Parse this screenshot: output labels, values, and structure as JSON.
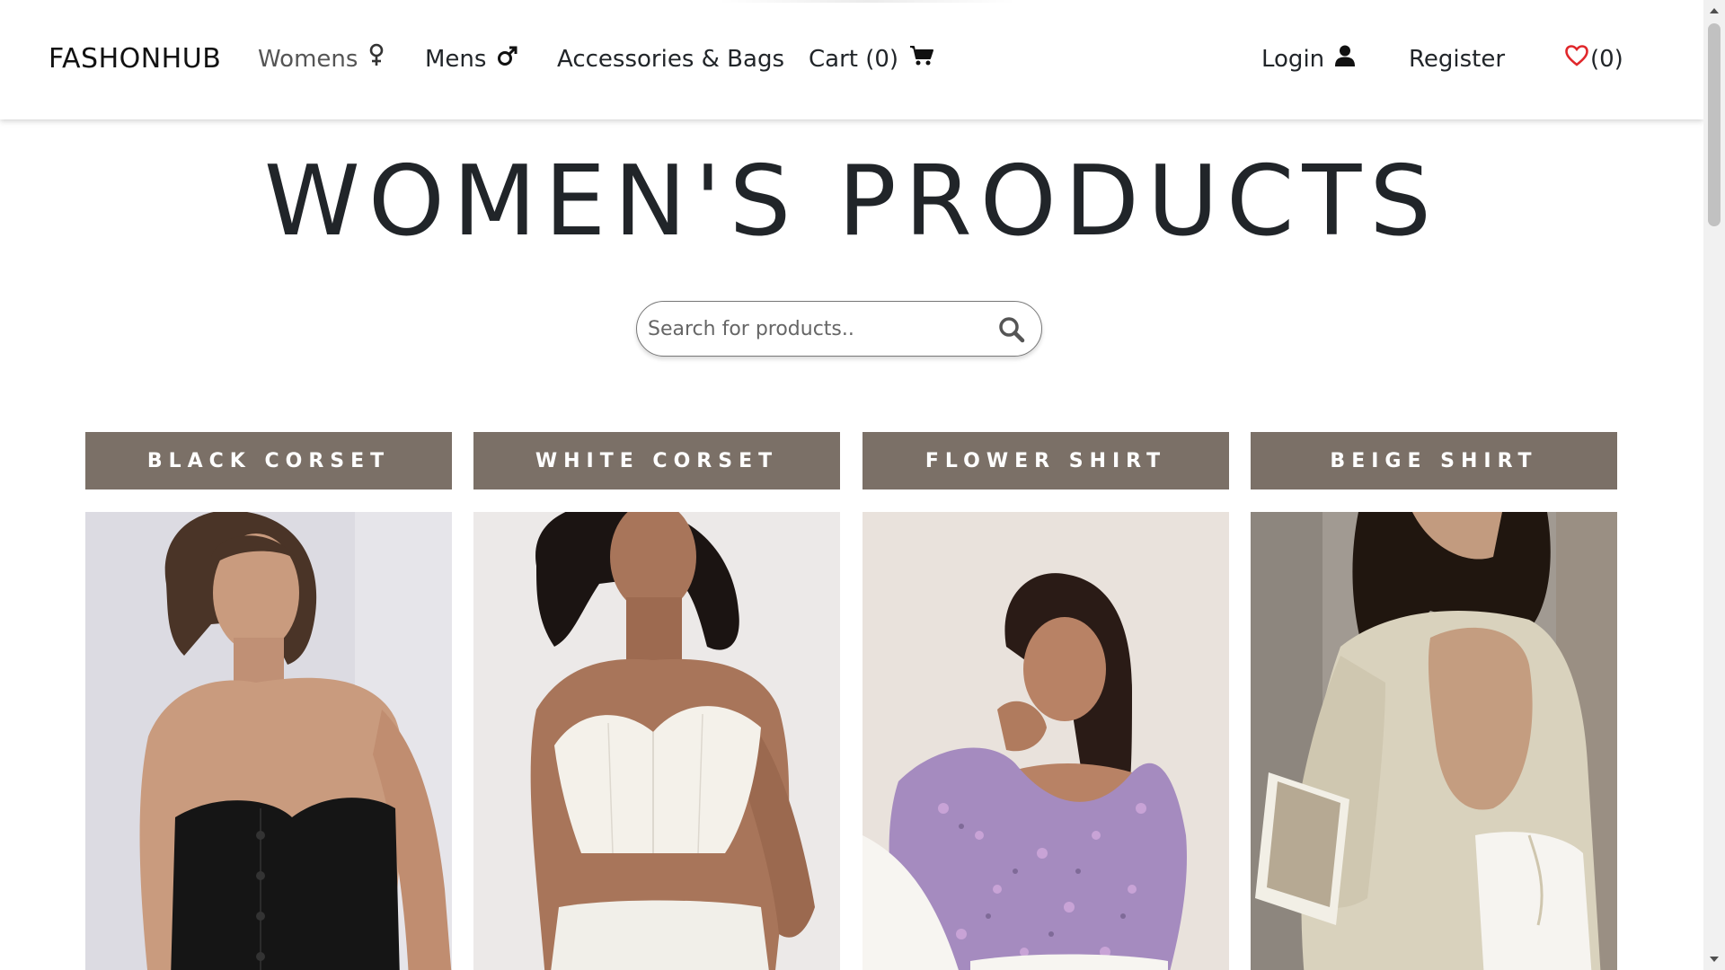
{
  "nav": {
    "brand": "FASHONHUB",
    "womens": "Womens",
    "mens": "Mens",
    "accessories": "Accessories & Bags",
    "cart": "Cart (0)",
    "login": "Login",
    "register": "Register",
    "wishlist": "(0)",
    "icons": {
      "womens": "female-symbol-icon",
      "mens": "male-symbol-icon",
      "cart": "shopping-cart-icon",
      "login": "user-icon",
      "wishlist": "heart-icon"
    },
    "wishlist_color": "#e0272b"
  },
  "page": {
    "title": "WOMEN'S PRODUCTS"
  },
  "search": {
    "placeholder": "Search for products..",
    "icon": "search-icon"
  },
  "products": [
    {
      "name": "BLACK CORSET"
    },
    {
      "name": "WHITE CORSET"
    },
    {
      "name": "FLOWER SHIRT"
    },
    {
      "name": "BEIGE SHIRT"
    }
  ],
  "colors": {
    "product_title_bg": "#7b7067",
    "text": "#212529"
  }
}
